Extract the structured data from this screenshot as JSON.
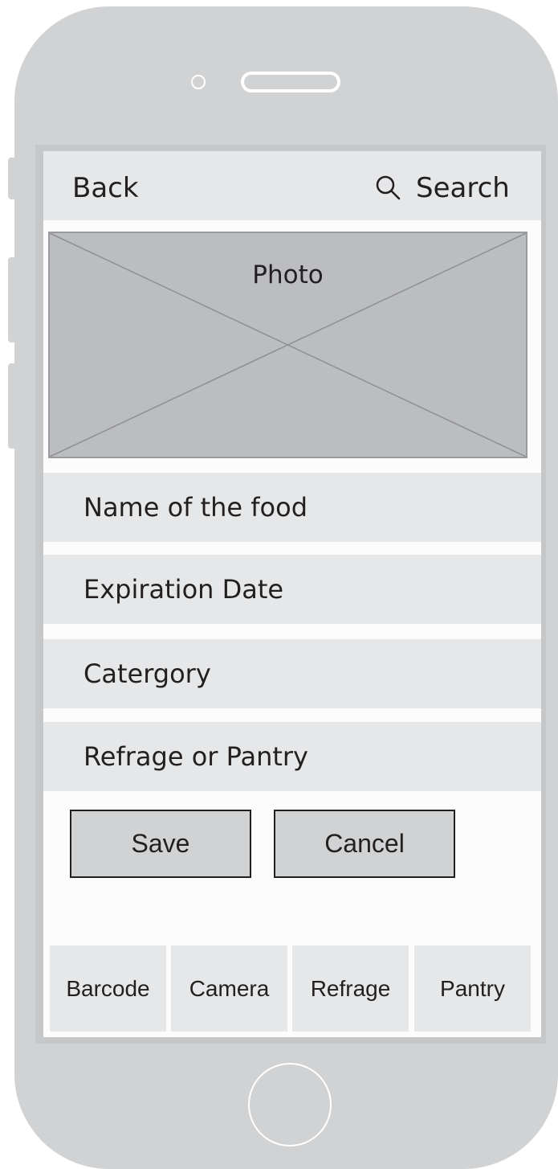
{
  "header": {
    "back_label": "Back",
    "search_label": "Search",
    "search_icon": "search-icon"
  },
  "photo": {
    "label": "Photo"
  },
  "fields": [
    {
      "label": "Name of the food"
    },
    {
      "label": "Expiration Date"
    },
    {
      "label": "Catergory"
    },
    {
      "label": "Refrage or Pantry"
    }
  ],
  "actions": {
    "save_label": "Save",
    "cancel_label": "Cancel"
  },
  "tabs": [
    {
      "label": "Barcode"
    },
    {
      "label": "Camera"
    },
    {
      "label": "Refrage"
    },
    {
      "label": "Pantry"
    }
  ],
  "colors": {
    "device": "#d1d2d4",
    "bar": "#e6e7e8",
    "photo": "#bcbdc0",
    "text": "#231f20"
  }
}
